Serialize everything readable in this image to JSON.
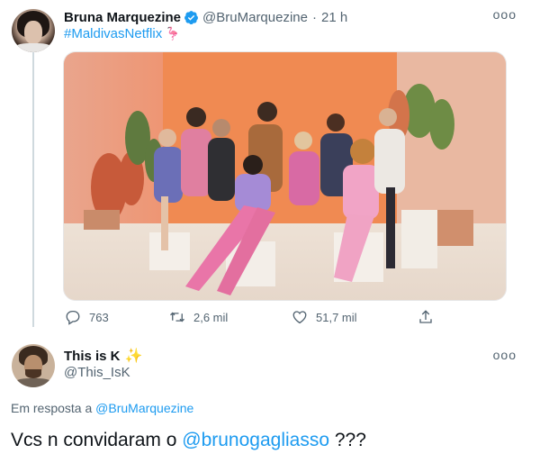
{
  "tweet": {
    "author_name": "Bruna Marquezine",
    "handle": "@BruMarquezine",
    "separator": "·",
    "time": "21 h",
    "hashtag": "#MaldivasNetflix",
    "more_label": "ooo",
    "icons": {
      "verified": "verified-badge-icon",
      "flamingo": "flamingo-emoji",
      "reply": "reply-icon",
      "retweet": "retweet-icon",
      "like": "heart-icon",
      "share": "share-icon"
    },
    "stats": {
      "replies": "763",
      "retweets": "2,6 mil",
      "likes": "51,7 mil"
    }
  },
  "reply": {
    "author_name": "This is K",
    "handle": "@This_IsK",
    "more_label": "ooo",
    "replying_prefix": "Em resposta a",
    "replying_to": "@BruMarquezine",
    "text_before": "Vcs n convidaram o",
    "text_mention": "@brunogagliasso",
    "text_after": "???"
  },
  "colors": {
    "accent": "#1d9bf0",
    "secondary_text": "#536471",
    "primary_text": "#0f1419",
    "thread_line": "#cfd9de"
  }
}
